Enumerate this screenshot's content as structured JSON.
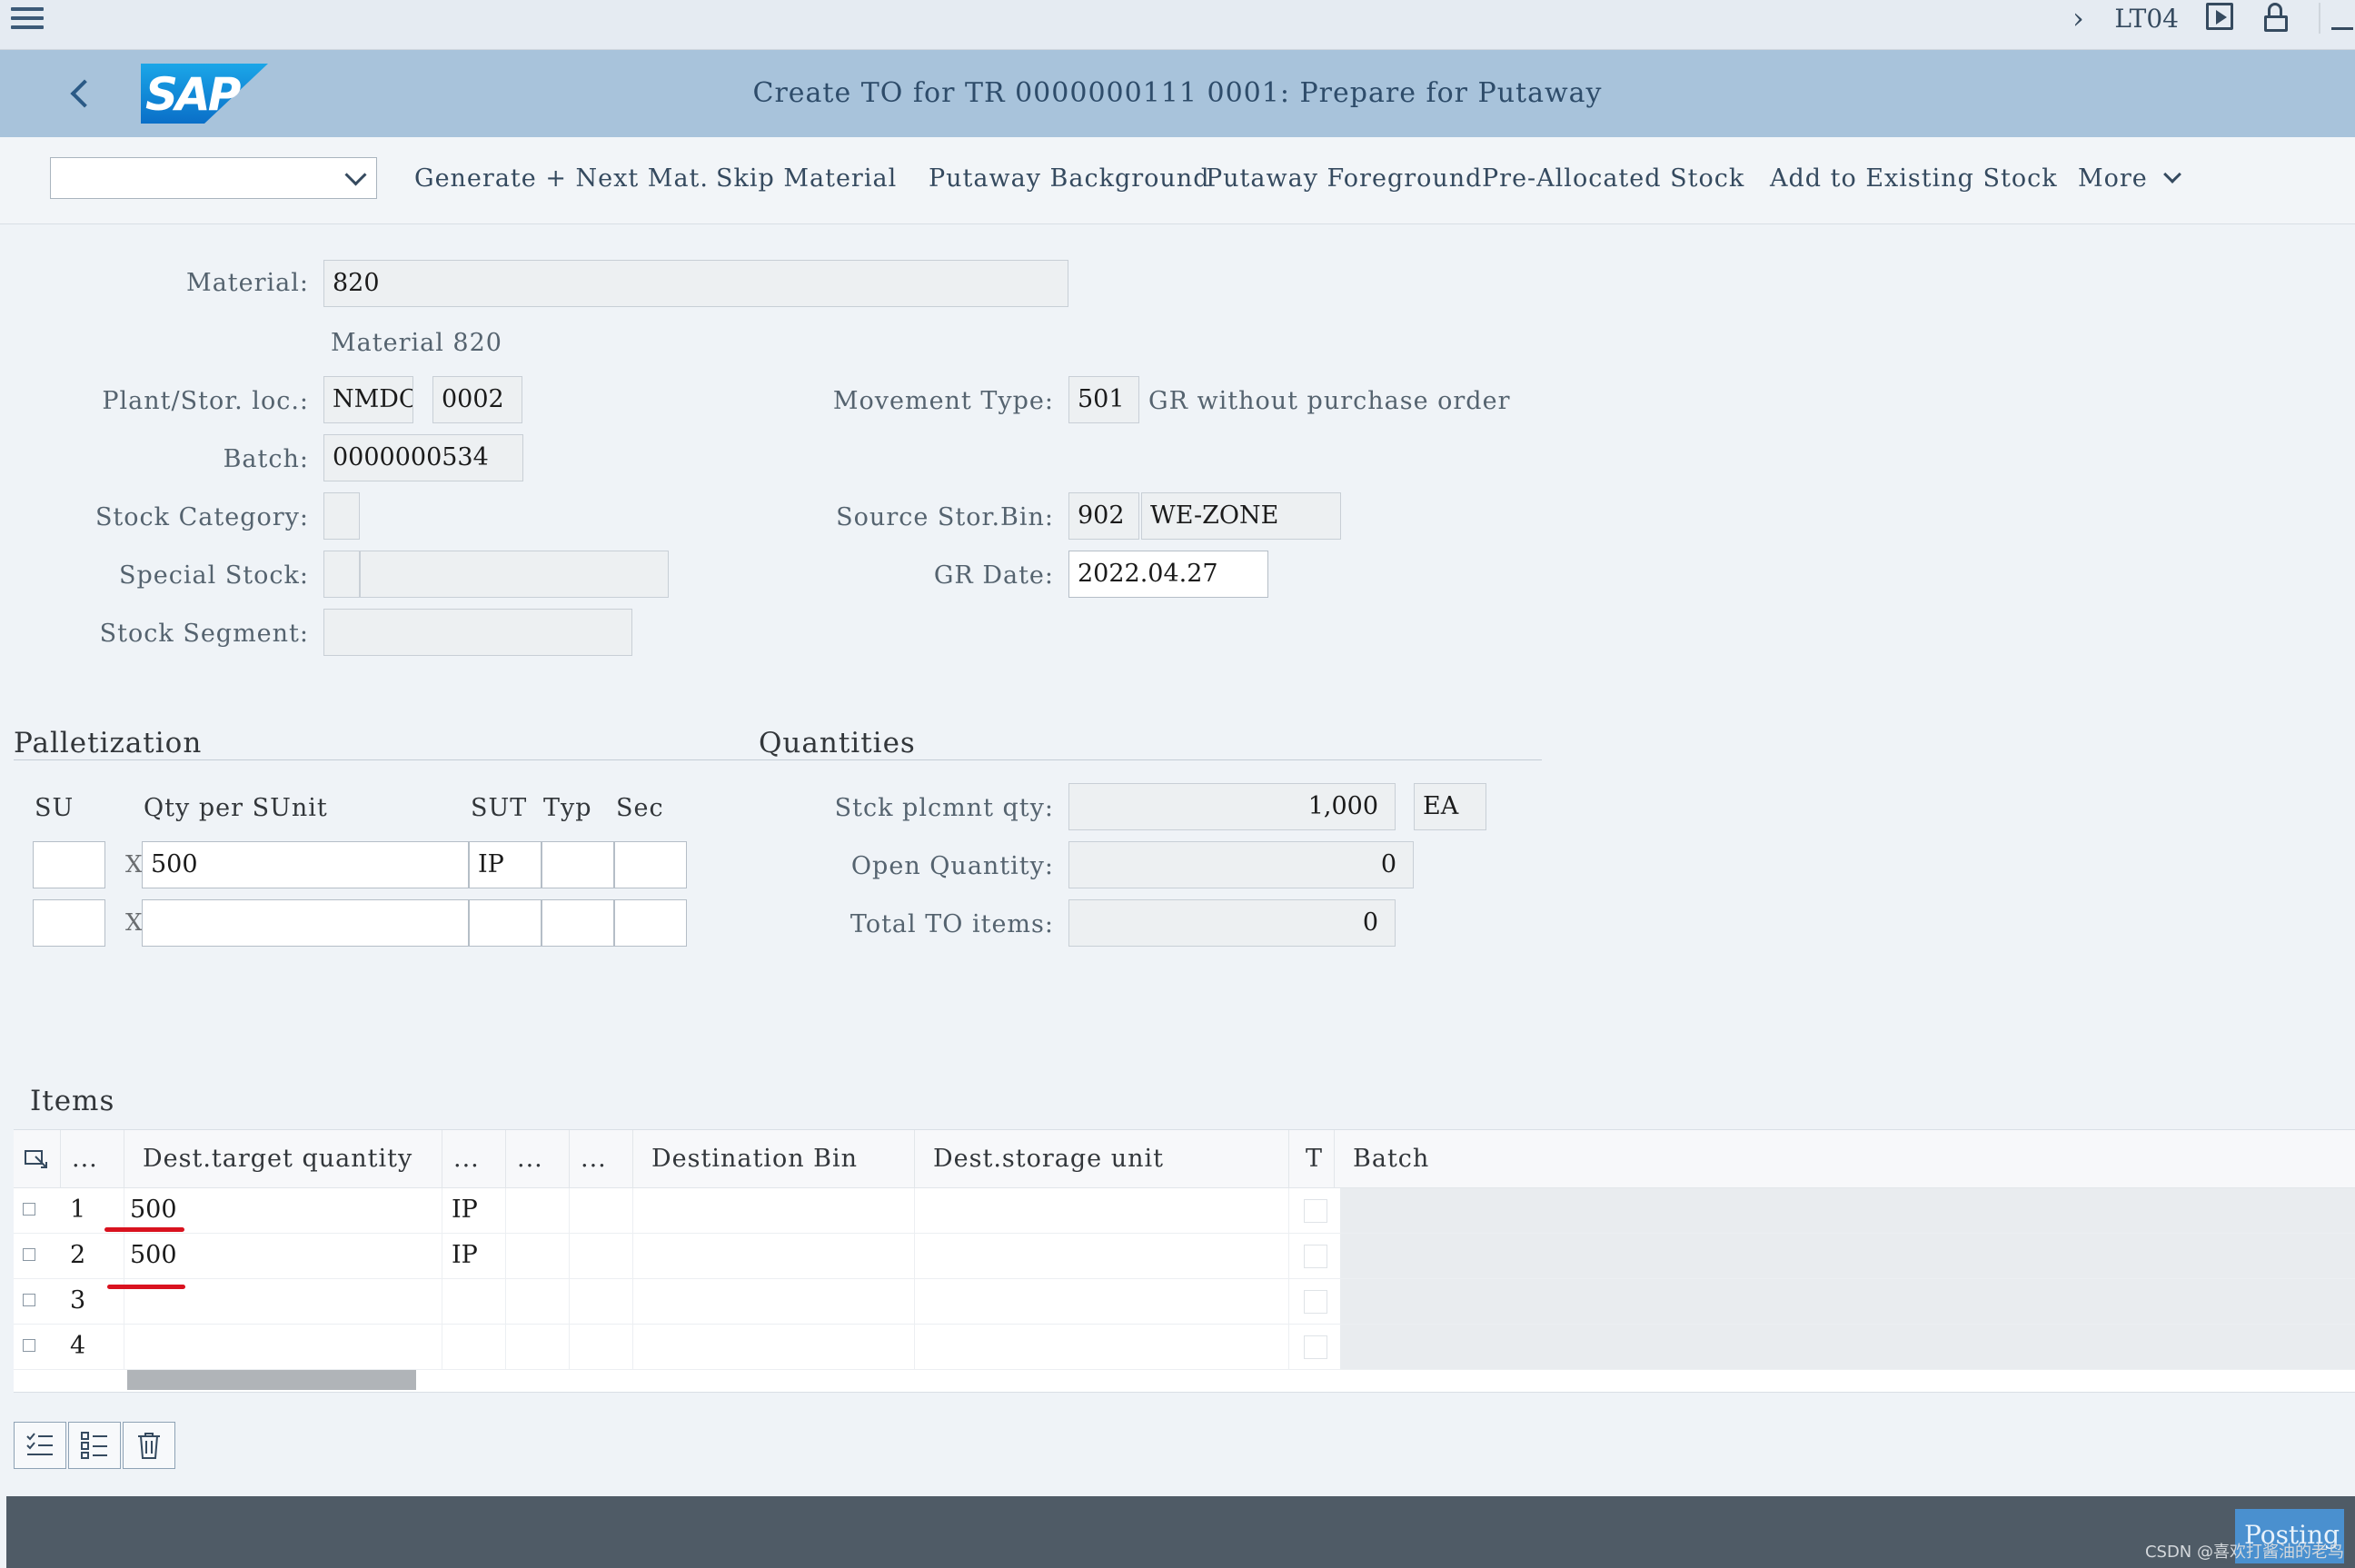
{
  "topbar": {
    "transaction_code": "LT04"
  },
  "title": {
    "text": "Create TO for TR 0000000111 0001: Prepare for Putaway"
  },
  "toolbar": {
    "select_value": "",
    "buttons": [
      "Generate + Next Mat.",
      "Skip Material",
      "Putaway Background",
      "Putaway Foreground",
      "Pre-Allocated Stock",
      "Add to Existing Stock",
      "More"
    ]
  },
  "form": {
    "material_label": "Material:",
    "material_value": "820",
    "material_desc": "Material 820",
    "plant_label": "Plant/Stor. loc.:",
    "plant_value": "NMDC",
    "storloc_value": "0002",
    "movement_label": "Movement Type:",
    "movement_value": "501",
    "movement_desc": "GR without purchase order",
    "batch_label": "Batch:",
    "batch_value": "0000000534",
    "stock_category_label": "Stock Category:",
    "stock_category_value": "",
    "source_bin_label": "Source Stor.Bin:",
    "source_bin_type": "902",
    "source_bin_value": "WE-ZONE",
    "special_stock_label": "Special Stock:",
    "gr_date_label": "GR Date:",
    "gr_date_value": "2022.04.27",
    "stock_segment_label": "Stock Segment:"
  },
  "palletization": {
    "title": "Palletization",
    "headers": {
      "su": "SU",
      "qty": "Qty per SUnit",
      "sut": "SUT",
      "typ": "Typ",
      "sec": "Sec"
    },
    "rows": [
      {
        "su": "",
        "x": "X",
        "qty": "500",
        "sut": "IP",
        "typ": "",
        "sec": ""
      },
      {
        "su": "",
        "x": "X",
        "qty": "",
        "sut": "",
        "typ": "",
        "sec": ""
      }
    ]
  },
  "quantities": {
    "title": "Quantities",
    "stock_label": "Stck plcmnt qty:",
    "stock_value": "1,000",
    "stock_unit": "EA",
    "open_label": "Open Quantity:",
    "open_value": "0",
    "total_label": "Total TO items:",
    "total_value": "0"
  },
  "items": {
    "title": "Items",
    "headers": [
      "...",
      "Dest.target quantity",
      "...",
      "...",
      "...",
      "Destination Bin",
      "Dest.storage unit",
      "T",
      "Batch"
    ],
    "rows": [
      {
        "no": "1",
        "qty": "500",
        "sut": "IP"
      },
      {
        "no": "2",
        "qty": "500",
        "sut": "IP"
      },
      {
        "no": "3",
        "qty": "",
        "sut": ""
      },
      {
        "no": "4",
        "qty": "",
        "sut": ""
      }
    ]
  },
  "footer": {
    "posting_label": "Posting",
    "watermark": "CSDN @喜欢打酱油的老鸟"
  }
}
